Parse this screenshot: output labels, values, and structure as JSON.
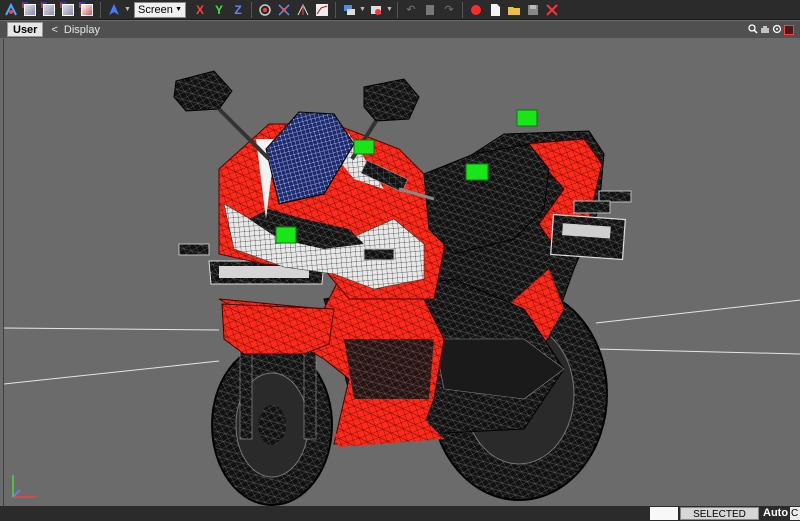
{
  "toolbar": {
    "coord_system": "Screen",
    "axis_x": "X",
    "axis_y": "Y",
    "axis_z": "Z"
  },
  "viewport_header": {
    "view_label": "User",
    "display_prefix": "<",
    "display_label": "Display"
  },
  "statusbar": {
    "field_value": "",
    "mode_label": "SELECTED MODE",
    "key_mode": "Auto",
    "trailing_label": "C"
  },
  "colors": {
    "accent_red": "#ff2a1a",
    "selection_green": "#19e619",
    "viewport_bg": "#6b6b6b"
  }
}
